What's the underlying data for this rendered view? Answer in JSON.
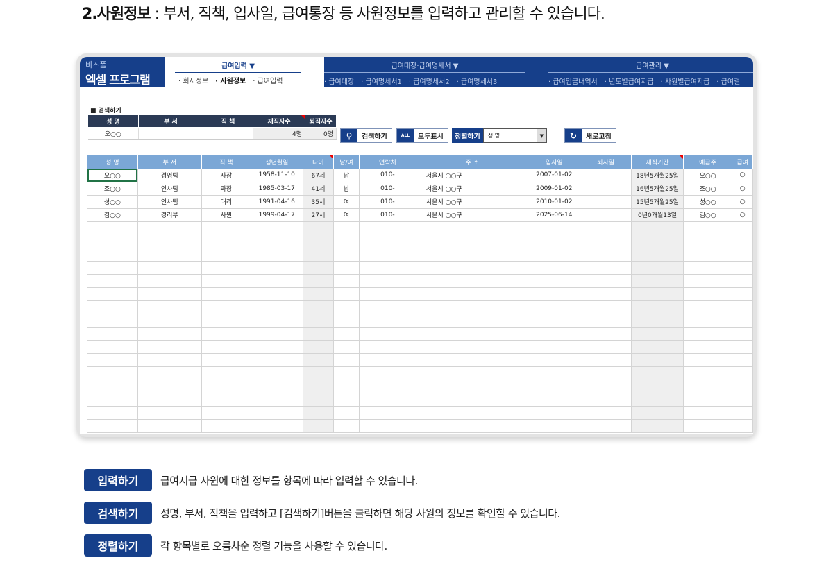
{
  "heading": {
    "number": "2.사원정보",
    "desc": " : 부서, 직책, 입사일, 급여통장 등 사원정보를 입력하고 관리할 수 있습니다."
  },
  "logo": {
    "small": "비즈폼",
    "big": "엑셀 프로그램"
  },
  "menu1": {
    "title": "급여입력 ▼",
    "items": [
      "· 회사정보",
      "· 사원정보",
      "· 급여입력"
    ]
  },
  "menu2": {
    "title": "급여대장·급여명세서 ▼",
    "items": [
      "· 급여대장",
      "· 급여명세서1",
      "· 급여명세서2",
      "· 급여명세서3"
    ]
  },
  "menu3": {
    "title": "급여관리 ▼",
    "items": [
      "· 급여입금내역서",
      "· 년도별급여지급",
      "· 사원별급여지급",
      "· 급여결"
    ]
  },
  "search": {
    "section": "■ 검색하기",
    "headers": [
      "성 명",
      "부 서",
      "직 책",
      "재직자수",
      "퇴직자수"
    ],
    "values": [
      "오○○",
      "",
      "",
      "4명",
      "0명"
    ]
  },
  "buttons": {
    "search": "검색하기",
    "showall": "모두표시",
    "sort": "정렬하기",
    "sort_value": "성 명",
    "refresh": "새로고침",
    "all_icon": "ALL"
  },
  "table": {
    "headers": [
      "성 명",
      "부 서",
      "직 책",
      "생년월일",
      "나이",
      "남/여",
      "연락처",
      "주 소",
      "입사일",
      "퇴사일",
      "재직기간",
      "예금주",
      "급여"
    ],
    "rows": [
      [
        "오○○",
        "경영팀",
        "사장",
        "1958-11-10",
        "67세",
        "남",
        "010-",
        "서울시 ○○구",
        "2007-01-02",
        "",
        "18년5개월25일",
        "오○○",
        "○"
      ],
      [
        "조○○",
        "인사팀",
        "과장",
        "1985-03-17",
        "41세",
        "남",
        "010-",
        "서울시 ○○구",
        "2009-01-02",
        "",
        "16년5개월25일",
        "조○○",
        "○"
      ],
      [
        "성○○",
        "인사팀",
        "대리",
        "1991-04-16",
        "35세",
        "여",
        "010-",
        "서울시 ○○구",
        "2010-01-02",
        "",
        "15년5개월25일",
        "성○○",
        "○"
      ],
      [
        "김○○",
        "경리부",
        "사원",
        "1999-04-17",
        "27세",
        "여",
        "010-",
        "서울시 ○○구",
        "2025-06-14",
        "",
        "0년0개월13일",
        "김○○",
        "○"
      ]
    ]
  },
  "features": [
    {
      "label": "입력하기",
      "text": "급여지급 사원에 대한 정보를 항목에 따라 입력할 수 있습니다."
    },
    {
      "label": "검색하기",
      "text": "성명, 부서, 직책을 입력하고 [검색하기]버튼을 클릭하면 해당 사원의 정보를 확인할 수 있습니다."
    },
    {
      "label": "정렬하기",
      "text": "각 항목별로 오름차순 정렬 기능을 사용할 수 있습니다."
    }
  ]
}
